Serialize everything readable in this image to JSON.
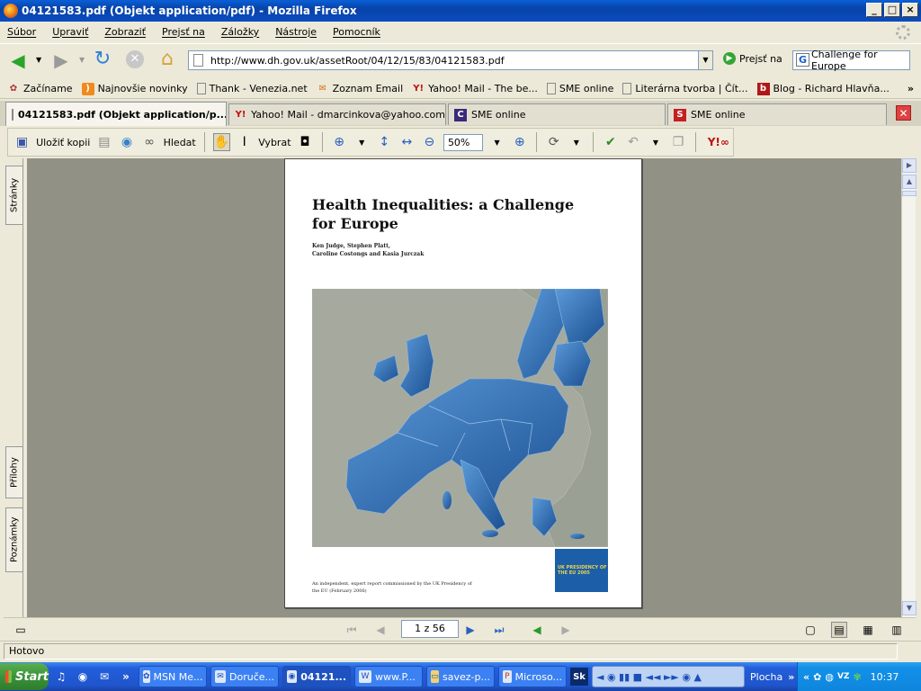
{
  "window": {
    "title": "04121583.pdf (Objekt application/pdf) - Mozilla Firefox",
    "controls": [
      "_",
      "□",
      "×"
    ]
  },
  "menu": [
    "Súbor",
    "Upraviť",
    "Zobraziť",
    "Prejsť na",
    "Záložky",
    "Nástroje",
    "Pomocník"
  ],
  "nav": {
    "url": "http://www.dh.gov.uk/assetRoot/04/12/15/83/04121583.pdf",
    "go_label": "Prejsť na",
    "search_value": "Challenge for Europe"
  },
  "bookmarks": [
    {
      "label": "Začíname",
      "icon": "firefox-icon"
    },
    {
      "label": "Najnovšie novinky",
      "icon": "rss-icon"
    },
    {
      "label": "Thank - Venezia.net",
      "icon": "page-icon"
    },
    {
      "label": "Zoznam Email",
      "icon": "mail-icon"
    },
    {
      "label": "Yahoo! Mail - The be...",
      "icon": "yahoo-icon"
    },
    {
      "label": "SME online",
      "icon": "page-icon"
    },
    {
      "label": "Literárna tvorba | Čít...",
      "icon": "page-icon"
    },
    {
      "label": "Blog - Richard Hlavňa...",
      "icon": "blog-icon"
    }
  ],
  "bookmarks_more": "»",
  "tabs": [
    {
      "label": "04121583.pdf (Objekt application/p...",
      "active": true,
      "icon": "page-icon"
    },
    {
      "label": "Yahoo! Mail - dmarcinkova@yahoo.com",
      "active": false,
      "icon": "yahoo-icon"
    },
    {
      "label": "SME online",
      "active": false,
      "icon": "c-icon"
    },
    {
      "label": "SME online",
      "active": false,
      "icon": "s-icon"
    }
  ],
  "pdf_toolbar": {
    "save_label": "Uložiť kopii",
    "search_label": "Hledat",
    "select_label": "Vybrat",
    "zoom": "50%"
  },
  "side_tabs": [
    "Stránky",
    "Přílohy",
    "Poznámky"
  ],
  "document": {
    "title": "Health Inequalities: a Challenge for Europe",
    "authors_line1": "Ken Judge, Stephen Platt,",
    "authors_line2": "Caroline Costongs and Kasia Jurczak",
    "footer": "An independent, expert report commissioned by the UK Presidency of the EU (February 2006)",
    "logo_text": "UK PRESIDENCY OF THE EU 2005"
  },
  "page_nav": {
    "page": "1 z 56"
  },
  "status": "Hotovo",
  "taskbar": {
    "start": "Start",
    "tasks": [
      {
        "label": "MSN Me...",
        "active": false
      },
      {
        "label": "Doruče...",
        "active": false
      },
      {
        "label": "04121...",
        "active": true
      },
      {
        "label": "www.P...",
        "active": false
      },
      {
        "label": "savez-p...",
        "active": false
      },
      {
        "label": "Microso...",
        "active": false
      }
    ],
    "desktop_label": "Plocha",
    "clock": "10:37"
  },
  "colors": {
    "titlebar": "#0a4cc0",
    "map_blue": "#1f5fa8",
    "map_grey": "#a6aa9e",
    "taskbar": "#245edb"
  }
}
